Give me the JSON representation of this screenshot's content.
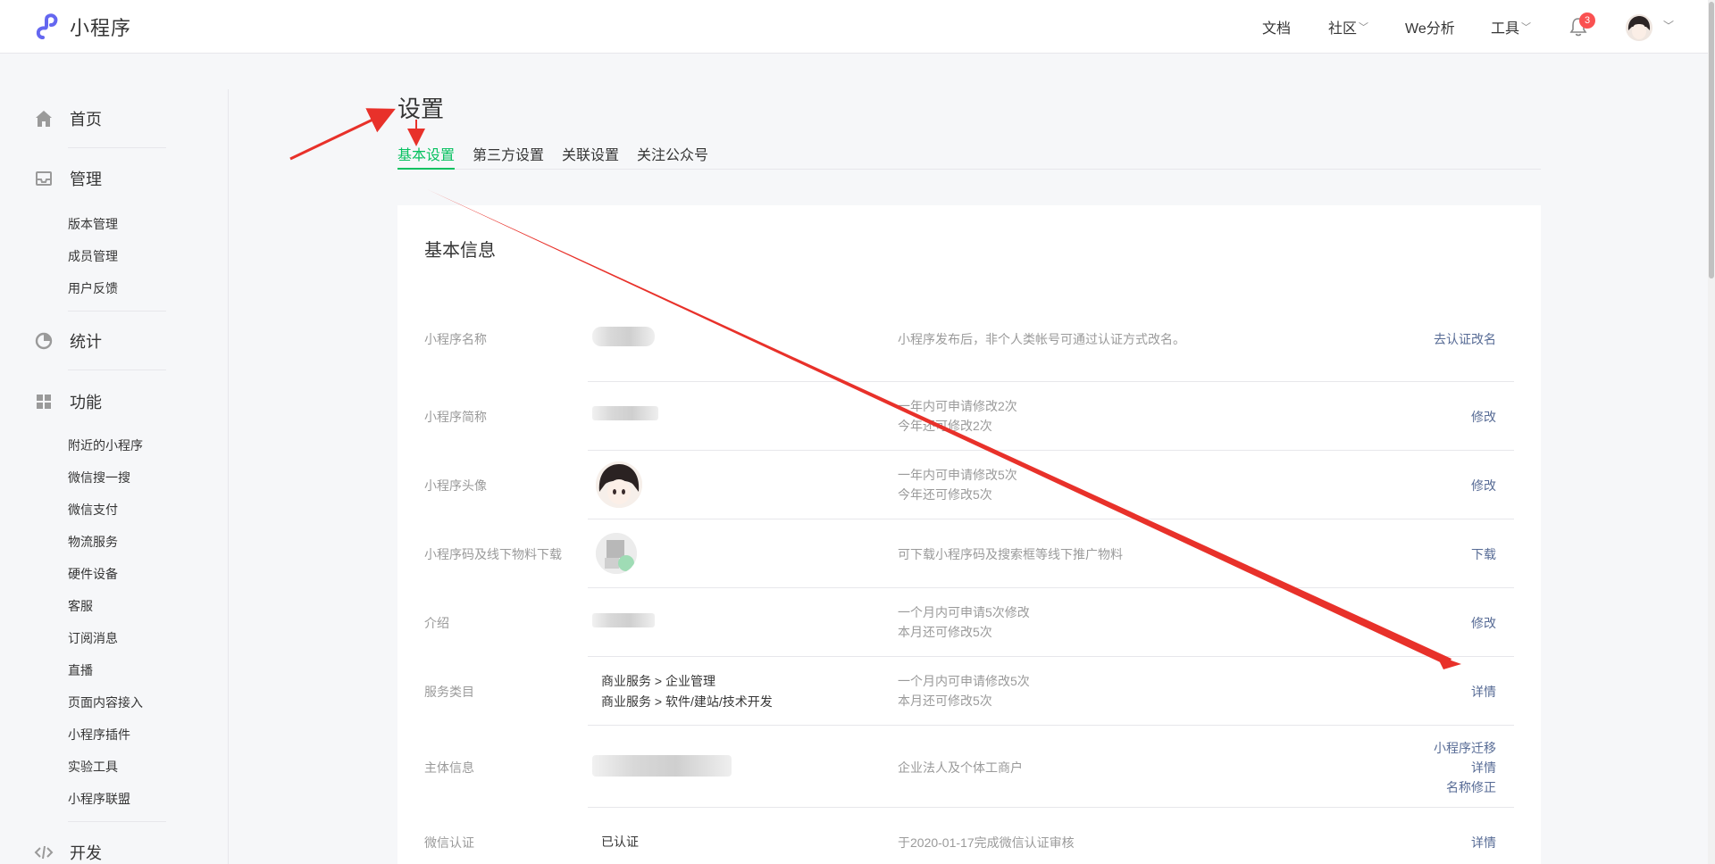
{
  "brand": {
    "name": "小程序",
    "logo": "miniprogram-logo-icon"
  },
  "topnav": {
    "docs": "文档",
    "community": "社区",
    "analytics": "We分析",
    "tools": "工具",
    "notification_count": "3"
  },
  "sidebar": {
    "home": "首页",
    "manage": {
      "title": "管理",
      "items": [
        "版本管理",
        "成员管理",
        "用户反馈"
      ]
    },
    "stats": "统计",
    "features": {
      "title": "功能",
      "items": [
        "附近的小程序",
        "微信搜一搜",
        "微信支付",
        "物流服务",
        "硬件设备",
        "客服",
        "订阅消息",
        "直播",
        "页面内容接入",
        "小程序插件",
        "实验工具",
        "小程序联盟"
      ]
    },
    "dev": "开发"
  },
  "page": {
    "title": "设置",
    "tabs": [
      "基本设置",
      "第三方设置",
      "关联设置",
      "关注公众号"
    ],
    "active_tab": "基本设置"
  },
  "card": {
    "title": "基本信息",
    "rows": [
      {
        "label": "小程序名称",
        "desc1": "小程序发布后，非个人类帐号可通过认证方式改名。",
        "action": "去认证改名"
      },
      {
        "label": "小程序简称",
        "desc1": "一年内可申请修改2次",
        "desc2": "今年还可修改2次",
        "action": "修改"
      },
      {
        "label": "小程序头像",
        "desc1": "一年内可申请修改5次",
        "desc2": "今年还可修改5次",
        "action": "修改"
      },
      {
        "label": "小程序码及线下物料下载",
        "desc1": "可下载小程序码及搜索框等线下推广物料",
        "action": "下载"
      },
      {
        "label": "介绍",
        "desc1": "一个月内可申请5次修改",
        "desc2": "本月还可修改5次",
        "action": "修改"
      },
      {
        "label": "服务类目",
        "value1": "商业服务 > 企业管理",
        "value2": "商业服务 > 软件/建站/技术开发",
        "desc1": "一个月内可申请修改5次",
        "desc2": "本月还可修改5次",
        "action": "详情"
      },
      {
        "label": "主体信息",
        "desc1": "企业法人及个体工商户",
        "actions": [
          "小程序迁移",
          "详情",
          "名称修正"
        ]
      },
      {
        "label": "微信认证",
        "value1": "已认证",
        "desc1": "于2020-01-17完成微信认证审核",
        "action": "详情"
      }
    ]
  },
  "colors": {
    "accent": "#07c160",
    "link": "#576b95",
    "annotation": "#e8312a",
    "badge": "#fa5151"
  }
}
